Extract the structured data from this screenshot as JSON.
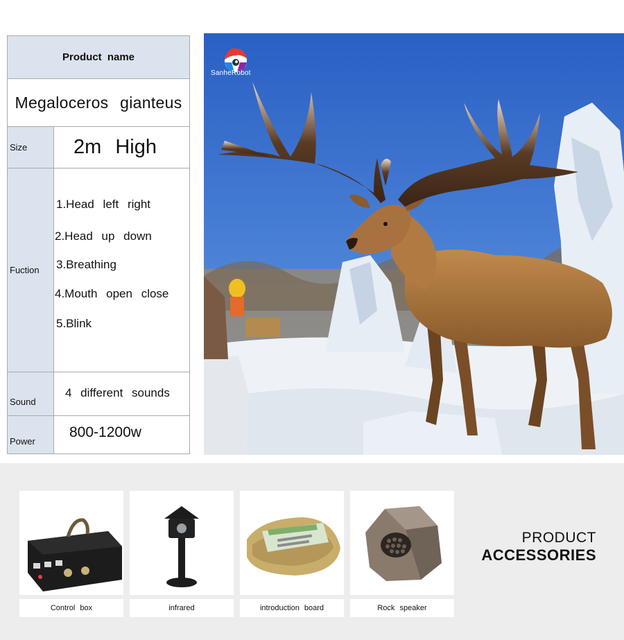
{
  "spec_table": {
    "product_name_label": "Product name",
    "product_name_value": "Megaloceros gianteus",
    "size_label": "Size",
    "size_value": "2m High",
    "function_label": "Fuction",
    "functions": [
      "1.Head left right",
      "2.Head up down",
      "3.Breathing",
      "4.Mouth open close",
      "5.Blink"
    ],
    "sound_label": "Sound",
    "sound_value": "4 different sounds",
    "power_label": "Power",
    "power_value": "800-1200w"
  },
  "photo": {
    "logo_text": "SanheRobot"
  },
  "accessories": {
    "title_line1": "PRODUCT",
    "title_line2": "ACCESSORIES",
    "items": [
      {
        "label": "Control box",
        "icon": "control-box-icon"
      },
      {
        "label": "infrared",
        "icon": "infrared-sensor-icon"
      },
      {
        "label": "introduction board",
        "icon": "introduction-board-icon"
      },
      {
        "label": "Rock speaker",
        "icon": "rock-speaker-icon"
      }
    ]
  },
  "colors": {
    "label_fill": "#dbe3ee",
    "border": "#a9a9a9",
    "sky": "#2f67c8",
    "band": "#ededed"
  }
}
